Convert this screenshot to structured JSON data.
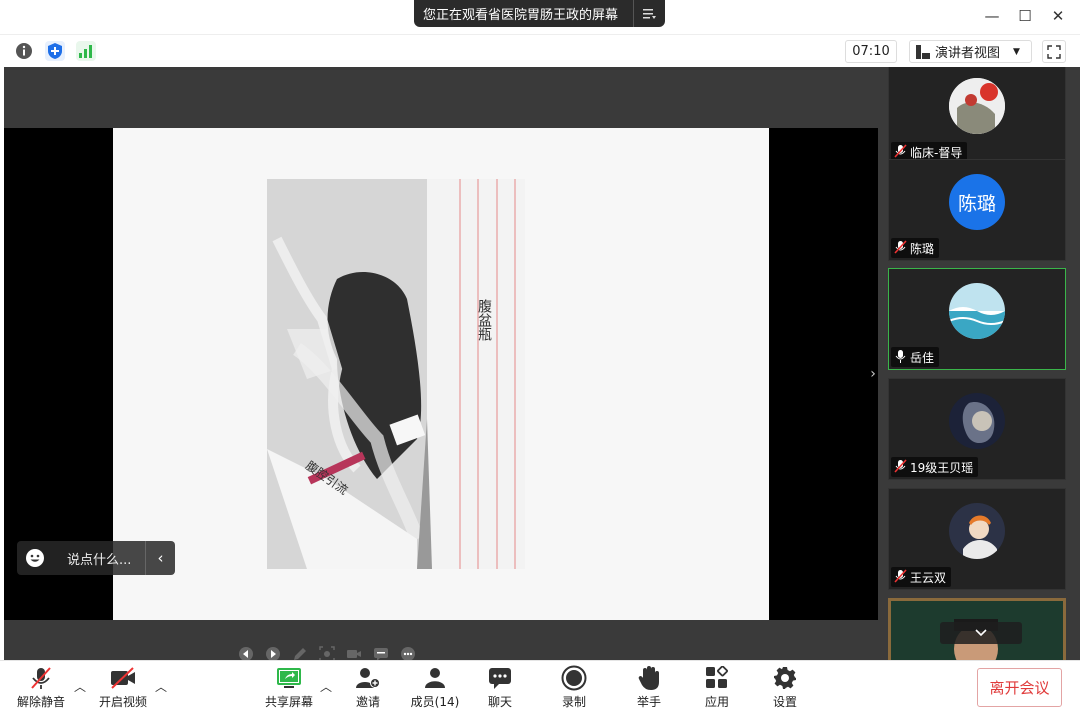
{
  "banner": {
    "text": "您正在观看省医院胃肠王政的屏幕"
  },
  "window": {
    "minimize": "—",
    "maximize": "☐",
    "close": "✕"
  },
  "topbar": {
    "timer": "07:10",
    "view_label": "演讲者视图",
    "icons": [
      "info-icon",
      "shield-icon",
      "signal-icon"
    ],
    "icon_colors": {
      "info": "#555555",
      "shield": "#1e6fe8",
      "signal": "#2eb84a"
    }
  },
  "chat": {
    "placeholder": "说点什么..."
  },
  "slide": {
    "note_text": "腹盆瓶",
    "bag_label": "腹腔引流"
  },
  "participants": [
    {
      "name": "临床-督导",
      "muted": true,
      "avatar": "photo"
    },
    {
      "name": "陈璐",
      "muted": true,
      "avatar": "initials",
      "initials": "陈璐",
      "color": "#1a73e8"
    },
    {
      "name": "岳佳",
      "muted": false,
      "avatar": "photo",
      "active": true
    },
    {
      "name": "19级王贝瑶",
      "muted": true,
      "avatar": "photo"
    },
    {
      "name": "王云双",
      "muted": true,
      "avatar": "photo"
    }
  ],
  "bottombar": {
    "unmute": "解除静音",
    "video": "开启视频",
    "share": "共享屏幕",
    "invite": "邀请",
    "members": "成员(14)",
    "chat": "聊天",
    "record": "录制",
    "raise_hand": "举手",
    "apps": "应用",
    "settings": "设置",
    "leave": "离开会议"
  },
  "colors": {
    "accent_green": "#2eb84a",
    "leave_red": "#e03a3a",
    "active_border": "#3ab54a"
  }
}
